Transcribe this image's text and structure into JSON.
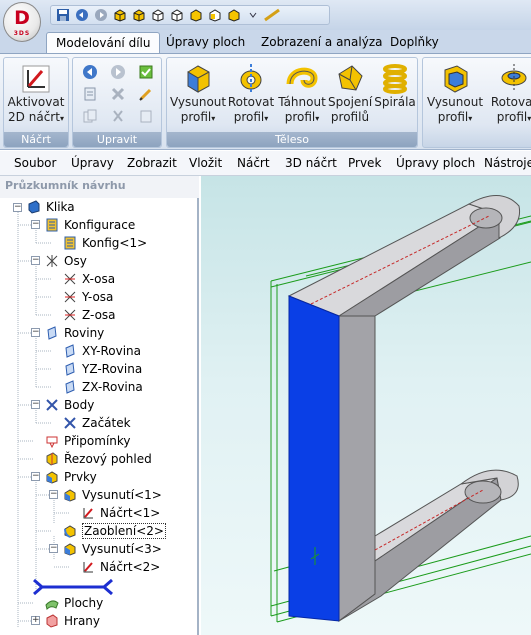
{
  "app": {
    "logo_letter": "D",
    "logo_sub": "3DS"
  },
  "quick_access": [
    "save-icon",
    "undo-icon",
    "redo-icon",
    "cube-view-1-icon",
    "cube-view-2-icon",
    "cube-view-3-icon",
    "cube-view-4-icon",
    "cube-view-5-icon",
    "cube-view-6-icon",
    "cube-view-7-icon",
    "more-icon",
    "ruler-icon"
  ],
  "ribbon_tabs": [
    "Modelování dílu",
    "Úpravy ploch",
    "Zobrazení a analýza",
    "Doplňky"
  ],
  "groups": {
    "sketch": "Náčrt",
    "edit": "Upravit",
    "solid": "Těleso"
  },
  "buttons": {
    "activate_line1": "Aktivovat",
    "activate_line2": "2D náčrt",
    "extrude_line1": "Vysunout",
    "extrude_line2": "profil",
    "revolve_line1": "Rotovat",
    "revolve_line2": "profil",
    "sweep_line1": "Táhnout",
    "sweep_line2": "profil",
    "loft_line1": "Spojení",
    "loft_line2": "profilů",
    "helix": "Spirála",
    "cut_extrude_line1": "Vysunout",
    "cut_extrude_line2": "profil",
    "cut_revolve_line1": "Rotovat",
    "cut_revolve_line2": "profil"
  },
  "menu": [
    "Soubor",
    "Úpravy",
    "Zobrazit",
    "Vložit",
    "Náčrt",
    "3D náčrt",
    "Prvek",
    "Úpravy ploch",
    "Nástroje"
  ],
  "panel_title": "Průzkumník návrhu",
  "tree": [
    {
      "label": "Klika"
    },
    {
      "label": "Konfigurace"
    },
    {
      "label": "Konfig<1>"
    },
    {
      "label": "Osy"
    },
    {
      "label": "X-osa"
    },
    {
      "label": "Y-osa"
    },
    {
      "label": "Z-osa"
    },
    {
      "label": "Roviny"
    },
    {
      "label": "XY-Rovina"
    },
    {
      "label": "YZ-Rovina"
    },
    {
      "label": "ZX-Rovina"
    },
    {
      "label": "Body"
    },
    {
      "label": "Začátek"
    },
    {
      "label": "Připomínky"
    },
    {
      "label": "Řezový pohled"
    },
    {
      "label": "Prvky"
    },
    {
      "label": "Vysunutí<1>"
    },
    {
      "label": "Náčrt<1>"
    },
    {
      "label": "Zaoblení<2>"
    },
    {
      "label": "Vysunutí<3>"
    },
    {
      "label": "Náčrt<2>"
    },
    {
      "label": ""
    },
    {
      "label": "Plochy"
    },
    {
      "label": "Hrany"
    }
  ],
  "colors": {
    "accent_red": "#c8001e",
    "part_blue": "#0a3fe6",
    "part_gray": "#a9a9ad",
    "wire_green": "#1c9c1c",
    "viewport_top": "#c6e4e6"
  }
}
